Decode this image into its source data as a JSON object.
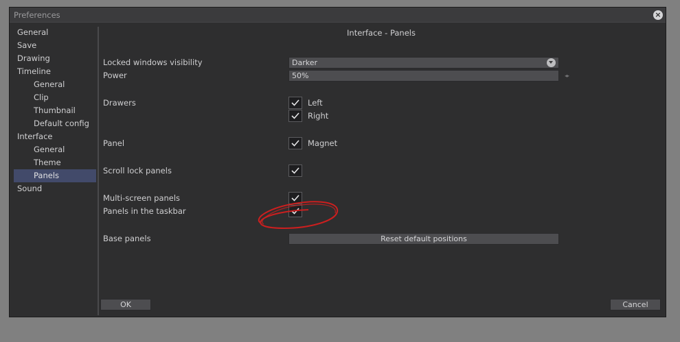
{
  "window": {
    "title": "Preferences"
  },
  "sidebar": {
    "items": [
      {
        "label": "General",
        "level": 0,
        "selected": false
      },
      {
        "label": "Save",
        "level": 0,
        "selected": false
      },
      {
        "label": "Drawing",
        "level": 0,
        "selected": false
      },
      {
        "label": "Timeline",
        "level": 0,
        "selected": false
      },
      {
        "label": "General",
        "level": 1,
        "selected": false
      },
      {
        "label": "Clip",
        "level": 1,
        "selected": false
      },
      {
        "label": "Thumbnail",
        "level": 1,
        "selected": false
      },
      {
        "label": "Default config",
        "level": 1,
        "selected": false
      },
      {
        "label": "Interface",
        "level": 0,
        "selected": false
      },
      {
        "label": "General",
        "level": 1,
        "selected": false
      },
      {
        "label": "Theme",
        "level": 1,
        "selected": false
      },
      {
        "label": "Panels",
        "level": 1,
        "selected": true
      },
      {
        "label": "Sound",
        "level": 0,
        "selected": false
      }
    ]
  },
  "main": {
    "heading": "Interface - Panels",
    "locked_windows": {
      "label": "Locked windows visibility",
      "value": "Darker"
    },
    "power": {
      "label": "Power",
      "value": "50%"
    },
    "drawers": {
      "label": "Drawers",
      "left_label": "Left",
      "left_checked": true,
      "right_label": "Right",
      "right_checked": true
    },
    "panel": {
      "label": "Panel",
      "magnet_label": "Magnet",
      "magnet_checked": true
    },
    "scroll_lock": {
      "label": "Scroll lock panels",
      "checked": true
    },
    "multi_screen": {
      "label": "Multi-screen panels",
      "checked": true
    },
    "taskbar": {
      "label": "Panels in the taskbar",
      "checked": true
    },
    "base_panels": {
      "label": "Base panels",
      "button": "Reset default positions"
    }
  },
  "footer": {
    "ok": "OK",
    "cancel": "Cancel"
  },
  "colors": {
    "selected_nav": "#424a6a",
    "annotation": "#cc1f1f",
    "window_bg": "#2e2e2f"
  }
}
